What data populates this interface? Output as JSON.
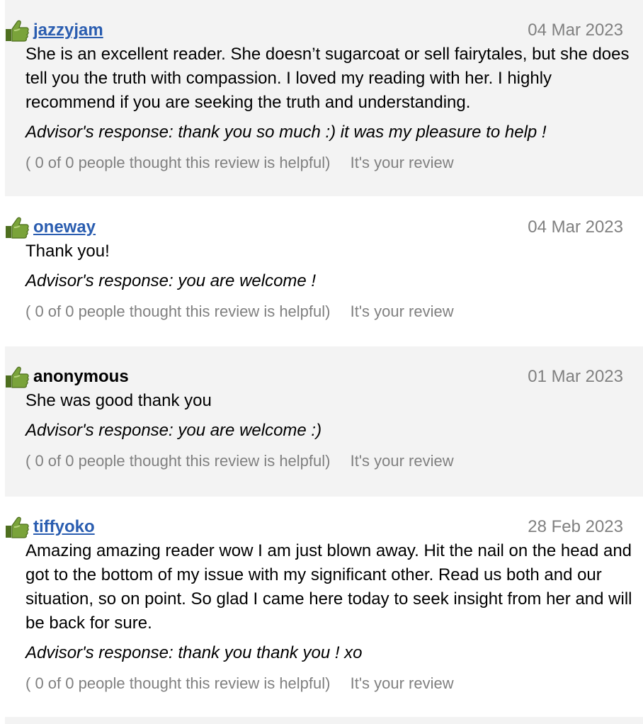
{
  "reviews": [
    {
      "username": "jazzyjam",
      "date": "04 Mar 2023",
      "text": "She is an excellent reader. She doesn’t sugarcoat or sell fairytales, but she does tell you the truth with compassion. I loved my reading with her. I highly recommend if you are seeking the truth and understanding.",
      "response": "Advisor's response: thank you so much :) it was my pleasure to help !",
      "helpful": "( 0 of 0 people thought this review is helpful)",
      "own": "It's your review"
    },
    {
      "username": "oneway",
      "date": "04 Mar 2023",
      "text": "Thank you!",
      "response": "Advisor's response: you are welcome !",
      "helpful": "( 0 of 0 people thought this review is helpful)",
      "own": "It's your review"
    },
    {
      "username": "anonymous",
      "date": "01 Mar 2023",
      "text": "She was good thank you",
      "response": "Advisor's response: you are welcome :)",
      "helpful": "( 0 of 0 people thought this review is helpful)",
      "own": "It's your review"
    },
    {
      "username": "tiffyoko",
      "date": "28 Feb 2023",
      "text": "Amazing amazing reader wow I am just blown away. Hit the nail on the head and got to the bottom of my issue with my significant other. Read us both and our situation, so on point. So glad I came here today to seek insight from her and will be back for sure.",
      "response": "Advisor's response: thank you thank you ! xo",
      "helpful": "( 0 of 0 people thought this review is helpful)",
      "own": "It's your review"
    }
  ],
  "icons": {
    "rating": "thumbs-up-icon"
  },
  "colors": {
    "link": "#2a5db0",
    "muted": "#808080",
    "shaded_row": "#f3f3f3",
    "thumb_green": "#7aa33a"
  }
}
